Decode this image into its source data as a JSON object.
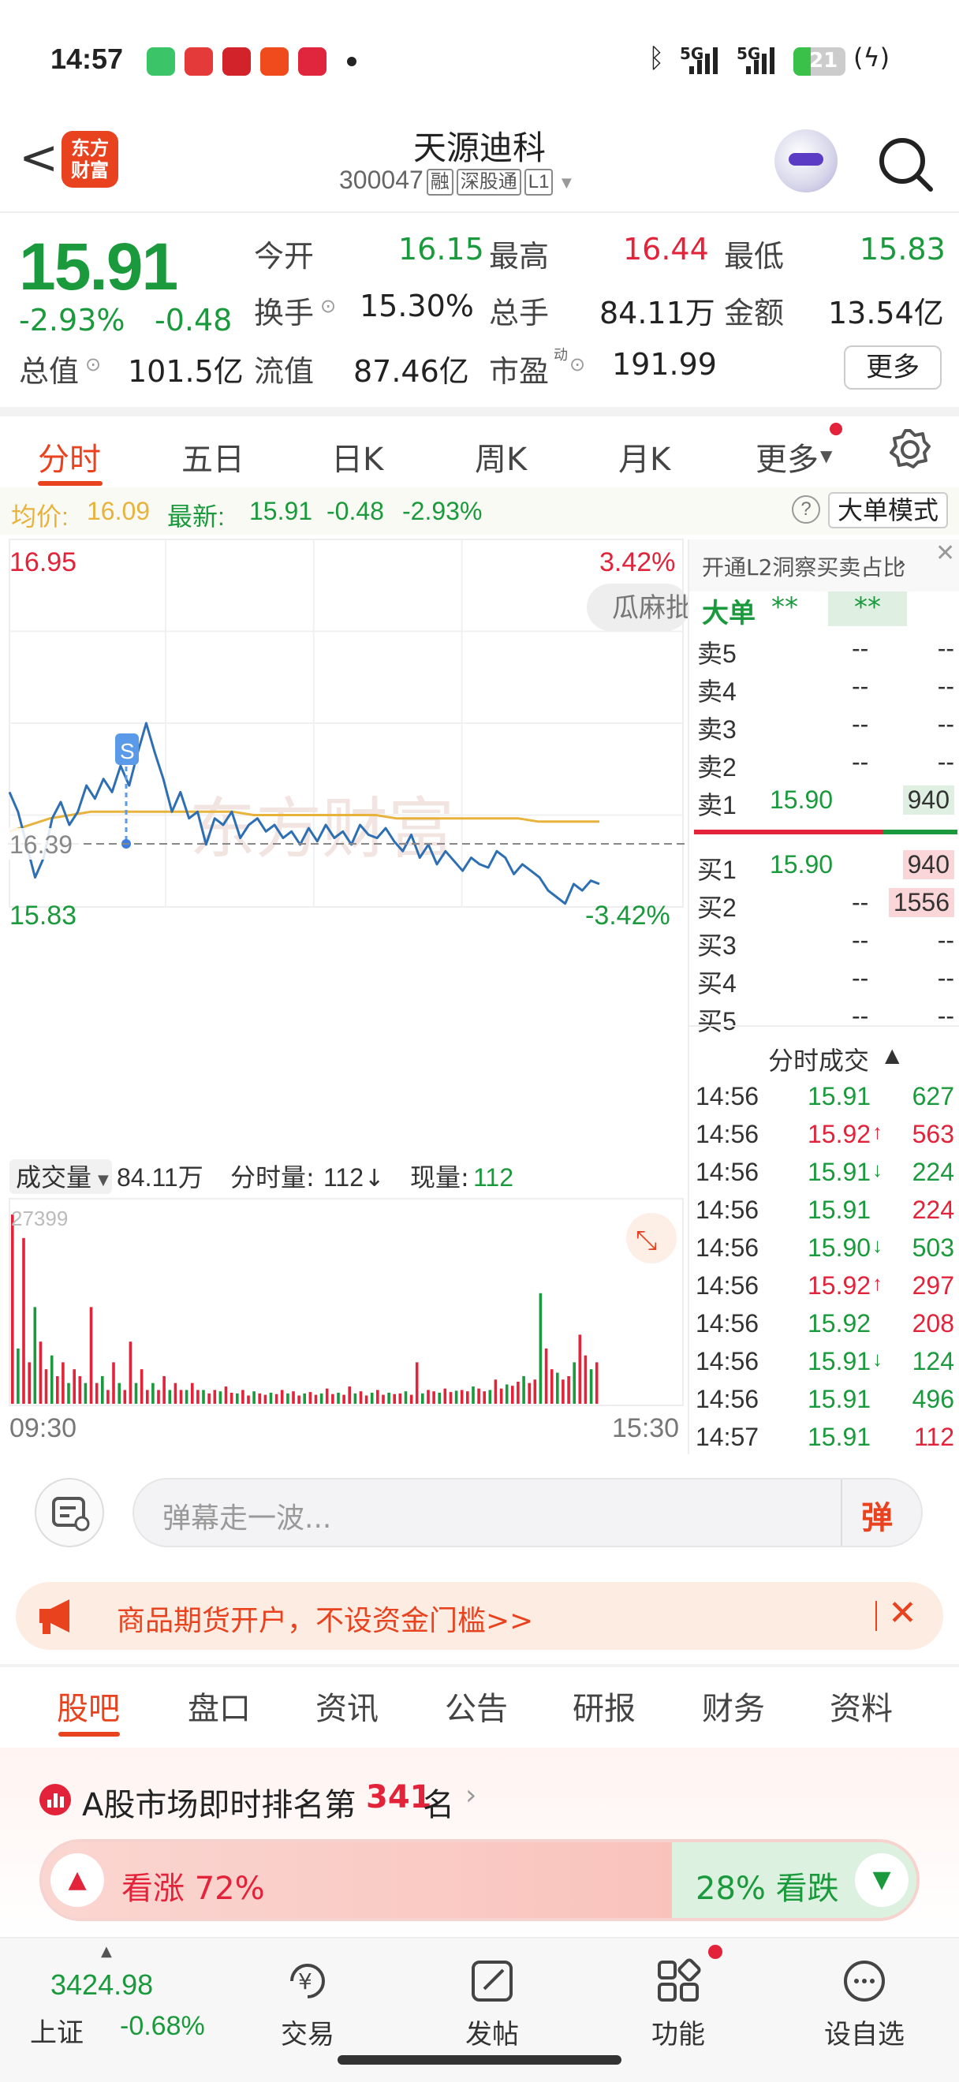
{
  "status_bar": {
    "time": "14:57",
    "battery": "21",
    "signal_5g_1": "5G",
    "signal_5g_2": "5G"
  },
  "header": {
    "logo_text": "东方财富",
    "stock_name": "天源迪科",
    "code": "300047",
    "tags": [
      "融",
      "深股通",
      "L1"
    ]
  },
  "quote": {
    "price": "15.91",
    "change_pct": "-2.93%",
    "change": "-0.48",
    "rows": [
      [
        {
          "k": "今开",
          "v": "16.15",
          "c": "green"
        },
        {
          "k": "最高",
          "v": "16.44",
          "c": "red"
        },
        {
          "k": "最低",
          "v": "15.83",
          "c": "green"
        }
      ],
      [
        {
          "k": "换手",
          "v": "15.30%",
          "c": "dark"
        },
        {
          "k": "总手",
          "v": "84.11万",
          "c": "dark"
        },
        {
          "k": "金额",
          "v": "13.54亿",
          "c": "dark"
        }
      ],
      [
        {
          "k": "总值",
          "v": "101.5亿",
          "c": "dark"
        },
        {
          "k": "流值",
          "v": "87.46亿",
          "c": "dark"
        },
        {
          "k": "市盈",
          "v": "191.99",
          "c": "dark"
        }
      ]
    ],
    "pe_sup": "动",
    "more_button": "更多"
  },
  "chart_tabs": [
    "分时",
    "五日",
    "日K",
    "周K",
    "月K",
    "更多"
  ],
  "avg_line": {
    "avg_label": "均价:",
    "avg_value": "16.09",
    "latest_label": "最新:",
    "latest_value": "15.91",
    "latest_change": "-0.48",
    "latest_pct": "-2.93%",
    "mode_button": "大单模式"
  },
  "chart_data": {
    "type": "line",
    "title": "",
    "y_max_label": "16.95",
    "y_min_label": "15.83",
    "y_pct_max": "3.42%",
    "y_pct_min": "-3.42%",
    "reference_label": "16.39",
    "watermark": "东方财富",
    "overlay_text": "瓜麻批",
    "marker_label": "S",
    "ylim": [
      15.83,
      16.95
    ],
    "price_series": [
      16.18,
      16.12,
      16.02,
      15.92,
      15.98,
      16.1,
      16.15,
      16.08,
      16.12,
      16.2,
      16.16,
      16.22,
      16.18,
      16.26,
      16.2,
      16.3,
      16.39,
      16.3,
      16.22,
      16.12,
      16.18,
      16.1,
      16.12,
      16.02,
      16.1,
      16.08,
      16.12,
      16.04,
      16.08,
      16.1,
      16.06,
      16.08,
      16.04,
      16.06,
      16.02,
      16.07,
      16.03,
      16.08,
      16.04,
      16.06,
      16.02,
      16.08,
      16.05,
      16.04,
      16.07,
      16.03,
      16.0,
      16.05,
      15.98,
      16.02,
      15.96,
      16.0,
      15.97,
      15.94,
      15.98,
      15.96,
      15.95,
      16.0,
      15.98,
      15.93,
      15.96,
      15.94,
      15.92,
      15.88,
      15.86,
      15.84,
      15.9,
      15.88,
      15.91,
      15.9
    ],
    "avg_series": [
      16.06,
      16.08,
      16.1,
      16.11,
      16.12,
      16.12,
      16.12,
      16.12,
      16.12,
      16.12,
      16.12,
      16.12,
      16.11,
      16.11,
      16.11,
      16.11,
      16.11,
      16.11,
      16.11,
      16.1,
      16.1,
      16.1,
      16.1,
      16.1,
      16.1,
      16.1,
      16.09,
      16.09,
      16.09,
      16.09
    ],
    "volume_label": "成交量",
    "volume_total": "84.11万",
    "minute_volume_label": "分时量:",
    "minute_volume": "112",
    "current_volume_label": "现量:",
    "current_volume": "112",
    "volume_max": "27399",
    "x_start": "09:30",
    "x_end": "15:30",
    "volumes": [
      27399,
      8000,
      24000,
      6000,
      14000,
      9000,
      5000,
      7000,
      4000,
      6000,
      3000,
      5000,
      4000,
      3000,
      14000,
      3000,
      4000,
      2000,
      6000,
      3000,
      2000,
      9000,
      3000,
      5000,
      2000,
      3000,
      2000,
      4000,
      2000,
      3000,
      2000,
      2000,
      3000,
      2000,
      2000,
      1500,
      2000,
      1800,
      2500,
      1600,
      1500,
      2000,
      1200,
      1800,
      1500,
      1300,
      1600,
      1400,
      2000,
      1500,
      1800,
      1200,
      1500,
      1700,
      1300,
      1500,
      2200,
      1400,
      1600,
      1300,
      2500,
      1500,
      1800,
      1200,
      1600,
      2000,
      1300,
      1600,
      1400,
      1500,
      1800,
      1300,
      6000,
      1500,
      2000,
      1800,
      1600,
      2200,
      1700,
      1900,
      2000,
      1800,
      2500,
      2200,
      1800,
      2000,
      3500,
      2200,
      2800,
      2600,
      3200,
      4000,
      3000,
      3500,
      16000,
      8000,
      5000,
      4500,
      3500,
      4000,
      6000,
      10000,
      7000,
      5000,
      6000
    ]
  },
  "order_book": {
    "l2_banner": "开通L2洞察买卖占比",
    "big_order_label": "大单",
    "big_order_v1": "**",
    "big_order_v2": "**",
    "asks": [
      {
        "label": "卖5",
        "price": "--",
        "vol": "--"
      },
      {
        "label": "卖4",
        "price": "--",
        "vol": "--"
      },
      {
        "label": "卖3",
        "price": "--",
        "vol": "--"
      },
      {
        "label": "卖2",
        "price": "--",
        "vol": "--"
      },
      {
        "label": "卖1",
        "price": "15.90",
        "vol": "940"
      }
    ],
    "bids": [
      {
        "label": "买1",
        "price": "15.90",
        "vol": "940"
      },
      {
        "label": "买2",
        "price": "--",
        "vol": "1556"
      },
      {
        "label": "买3",
        "price": "--",
        "vol": "--"
      },
      {
        "label": "买4",
        "price": "--",
        "vol": "--"
      },
      {
        "label": "买5",
        "price": "--",
        "vol": "--"
      }
    ],
    "trades_title": "分时成交",
    "trades": [
      {
        "t": "14:56",
        "p": "15.91",
        "d": "",
        "v": "627",
        "c": "green"
      },
      {
        "t": "14:56",
        "p": "15.92",
        "d": "↑",
        "v": "563",
        "c": "red"
      },
      {
        "t": "14:56",
        "p": "15.91",
        "d": "↓",
        "v": "224",
        "c": "green"
      },
      {
        "t": "14:56",
        "p": "15.91",
        "d": "",
        "v": "224",
        "c": "red"
      },
      {
        "t": "14:56",
        "p": "15.90",
        "d": "↓",
        "v": "503",
        "c": "green"
      },
      {
        "t": "14:56",
        "p": "15.92",
        "d": "↑",
        "v": "297",
        "c": "red"
      },
      {
        "t": "14:56",
        "p": "15.92",
        "d": "",
        "v": "208",
        "c": "red"
      },
      {
        "t": "14:56",
        "p": "15.91",
        "d": "↓",
        "v": "124",
        "c": "green"
      },
      {
        "t": "14:56",
        "p": "15.91",
        "d": "",
        "v": "496",
        "c": "green"
      },
      {
        "t": "14:57",
        "p": "15.91",
        "d": "",
        "v": "112",
        "c": "red"
      }
    ]
  },
  "barrage": {
    "placeholder": "弹幕走一波...",
    "send_label": "弹"
  },
  "ad": {
    "text": "商品期货开户，不设资金门槛>>"
  },
  "bottom_tabs": [
    "股吧",
    "盘口",
    "资讯",
    "公告",
    "研报",
    "财务",
    "资料"
  ],
  "rank": {
    "prefix": "A股市场即时排名第",
    "number": "341",
    "suffix": "名",
    "up_label": "看涨 72%",
    "down_label": "28% 看跌",
    "up_fraction": 0.72
  },
  "nav": {
    "index_value": "3424.98",
    "index_name": "上证",
    "index_change": "-0.68%",
    "items": [
      "交易",
      "发帖",
      "功能",
      "设自选"
    ]
  },
  "colors": {
    "up": "#e2233a",
    "down": "#1a9a3c",
    "accent": "#e8421e",
    "price_line": "#2e6fb3",
    "avg_line": "#e8b33c"
  }
}
